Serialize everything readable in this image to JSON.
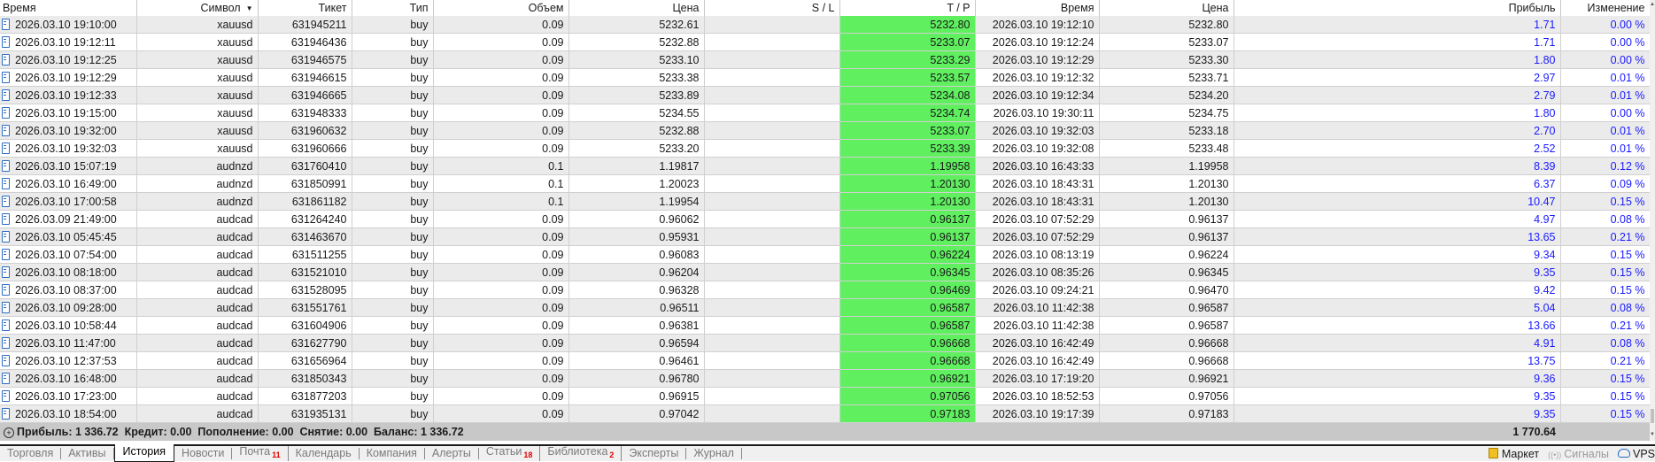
{
  "columns": [
    "Время",
    "Символ",
    "Тикет",
    "Тип",
    "Объем",
    "Цена",
    "S / L",
    "T / P",
    "Время",
    "Цена",
    "Прибыль",
    "Изменение"
  ],
  "rows": [
    [
      "2026.03.10 19:10:00",
      "xauusd",
      "631945211",
      "buy",
      "0.09",
      "5232.61",
      "",
      "5232.80",
      "2026.03.10 19:12:10",
      "5232.80",
      "1.71",
      "0.00 %"
    ],
    [
      "2026.03.10 19:12:11",
      "xauusd",
      "631946436",
      "buy",
      "0.09",
      "5232.88",
      "",
      "5233.07",
      "2026.03.10 19:12:24",
      "5233.07",
      "1.71",
      "0.00 %"
    ],
    [
      "2026.03.10 19:12:25",
      "xauusd",
      "631946575",
      "buy",
      "0.09",
      "5233.10",
      "",
      "5233.29",
      "2026.03.10 19:12:29",
      "5233.30",
      "1.80",
      "0.00 %"
    ],
    [
      "2026.03.10 19:12:29",
      "xauusd",
      "631946615",
      "buy",
      "0.09",
      "5233.38",
      "",
      "5233.57",
      "2026.03.10 19:12:32",
      "5233.71",
      "2.97",
      "0.01 %"
    ],
    [
      "2026.03.10 19:12:33",
      "xauusd",
      "631946665",
      "buy",
      "0.09",
      "5233.89",
      "",
      "5234.08",
      "2026.03.10 19:12:34",
      "5234.20",
      "2.79",
      "0.01 %"
    ],
    [
      "2026.03.10 19:15:00",
      "xauusd",
      "631948333",
      "buy",
      "0.09",
      "5234.55",
      "",
      "5234.74",
      "2026.03.10 19:30:11",
      "5234.75",
      "1.80",
      "0.00 %"
    ],
    [
      "2026.03.10 19:32:00",
      "xauusd",
      "631960632",
      "buy",
      "0.09",
      "5232.88",
      "",
      "5233.07",
      "2026.03.10 19:32:03",
      "5233.18",
      "2.70",
      "0.01 %"
    ],
    [
      "2026.03.10 19:32:03",
      "xauusd",
      "631960666",
      "buy",
      "0.09",
      "5233.20",
      "",
      "5233.39",
      "2026.03.10 19:32:08",
      "5233.48",
      "2.52",
      "0.01 %"
    ],
    [
      "2026.03.10 15:07:19",
      "audnzd",
      "631760410",
      "buy",
      "0.1",
      "1.19817",
      "",
      "1.19958",
      "2026.03.10 16:43:33",
      "1.19958",
      "8.39",
      "0.12 %"
    ],
    [
      "2026.03.10 16:49:00",
      "audnzd",
      "631850991",
      "buy",
      "0.1",
      "1.20023",
      "",
      "1.20130",
      "2026.03.10 18:43:31",
      "1.20130",
      "6.37",
      "0.09 %"
    ],
    [
      "2026.03.10 17:00:58",
      "audnzd",
      "631861182",
      "buy",
      "0.1",
      "1.19954",
      "",
      "1.20130",
      "2026.03.10 18:43:31",
      "1.20130",
      "10.47",
      "0.15 %"
    ],
    [
      "2026.03.09 21:49:00",
      "audcad",
      "631264240",
      "buy",
      "0.09",
      "0.96062",
      "",
      "0.96137",
      "2026.03.10 07:52:29",
      "0.96137",
      "4.97",
      "0.08 %"
    ],
    [
      "2026.03.10 05:45:45",
      "audcad",
      "631463670",
      "buy",
      "0.09",
      "0.95931",
      "",
      "0.96137",
      "2026.03.10 07:52:29",
      "0.96137",
      "13.65",
      "0.21 %"
    ],
    [
      "2026.03.10 07:54:00",
      "audcad",
      "631511255",
      "buy",
      "0.09",
      "0.96083",
      "",
      "0.96224",
      "2026.03.10 08:13:19",
      "0.96224",
      "9.34",
      "0.15 %"
    ],
    [
      "2026.03.10 08:18:00",
      "audcad",
      "631521010",
      "buy",
      "0.09",
      "0.96204",
      "",
      "0.96345",
      "2026.03.10 08:35:26",
      "0.96345",
      "9.35",
      "0.15 %"
    ],
    [
      "2026.03.10 08:37:00",
      "audcad",
      "631528095",
      "buy",
      "0.09",
      "0.96328",
      "",
      "0.96469",
      "2026.03.10 09:24:21",
      "0.96470",
      "9.42",
      "0.15 %"
    ],
    [
      "2026.03.10 09:28:00",
      "audcad",
      "631551761",
      "buy",
      "0.09",
      "0.96511",
      "",
      "0.96587",
      "2026.03.10 11:42:38",
      "0.96587",
      "5.04",
      "0.08 %"
    ],
    [
      "2026.03.10 10:58:44",
      "audcad",
      "631604906",
      "buy",
      "0.09",
      "0.96381",
      "",
      "0.96587",
      "2026.03.10 11:42:38",
      "0.96587",
      "13.66",
      "0.21 %"
    ],
    [
      "2026.03.10 11:47:00",
      "audcad",
      "631627790",
      "buy",
      "0.09",
      "0.96594",
      "",
      "0.96668",
      "2026.03.10 16:42:49",
      "0.96668",
      "4.91",
      "0.08 %"
    ],
    [
      "2026.03.10 12:37:53",
      "audcad",
      "631656964",
      "buy",
      "0.09",
      "0.96461",
      "",
      "0.96668",
      "2026.03.10 16:42:49",
      "0.96668",
      "13.75",
      "0.21 %"
    ],
    [
      "2026.03.10 16:48:00",
      "audcad",
      "631850343",
      "buy",
      "0.09",
      "0.96780",
      "",
      "0.96921",
      "2026.03.10 17:19:20",
      "0.96921",
      "9.36",
      "0.15 %"
    ],
    [
      "2026.03.10 17:23:00",
      "audcad",
      "631877203",
      "buy",
      "0.09",
      "0.96915",
      "",
      "0.97056",
      "2026.03.10 18:52:53",
      "0.97056",
      "9.35",
      "0.15 %"
    ],
    [
      "2026.03.10 18:54:00",
      "audcad",
      "631935131",
      "buy",
      "0.09",
      "0.97042",
      "",
      "0.97183",
      "2026.03.10 19:17:39",
      "0.97183",
      "9.35",
      "0.15 %"
    ]
  ],
  "footer": {
    "summary": "Прибыль: 1 336.72  Кредит: 0.00  Пополнение: 0.00  Снятие: 0.00  Баланс: 1 336.72",
    "total_profit": "1 770.64"
  },
  "tabs": [
    {
      "label": "Торговля",
      "badge": ""
    },
    {
      "label": "Активы",
      "badge": ""
    },
    {
      "label": "История",
      "badge": "",
      "active": true
    },
    {
      "label": "Новости",
      "badge": ""
    },
    {
      "label": "Почта",
      "badge": "11"
    },
    {
      "label": "Календарь",
      "badge": ""
    },
    {
      "label": "Компания",
      "badge": ""
    },
    {
      "label": "Алерты",
      "badge": ""
    },
    {
      "label": "Статьи",
      "badge": "18"
    },
    {
      "label": "Библиотека",
      "badge": "2"
    },
    {
      "label": "Эксперты",
      "badge": ""
    },
    {
      "label": "Журнал",
      "badge": ""
    }
  ],
  "tools": {
    "market": "Маркет",
    "signals": "Сигналы",
    "vps": "VPS"
  },
  "colors": {
    "tp_bg": "#5fef5f",
    "profit_text": "#1a1aff",
    "odd_row": "#ebebeb",
    "footer_bg": "#c8c8c8"
  }
}
